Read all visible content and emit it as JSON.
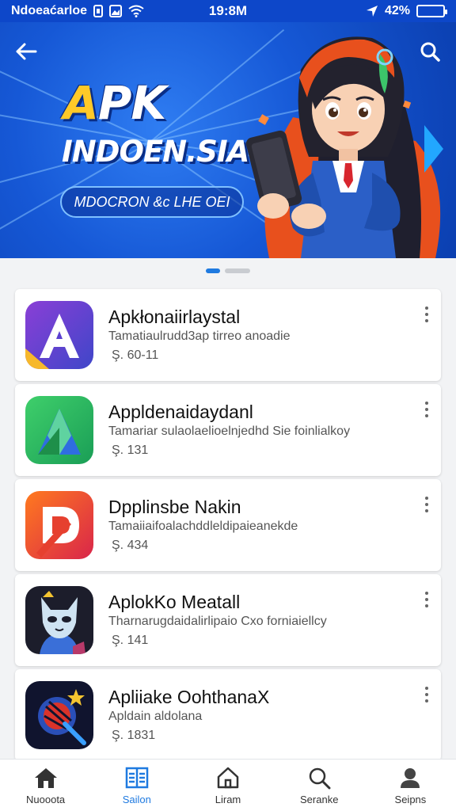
{
  "status_bar": {
    "carrier": "Ndoeaćarloe",
    "time": "19:8M",
    "battery_percent": "42%",
    "battery_level": 0.9
  },
  "hero": {
    "title": "APK",
    "subtitle": "INDOEN.SIA",
    "pill_text": "MDOCRON &c LHE OEI",
    "back_icon": "arrow-left-icon",
    "search_icon": "search-icon",
    "slide_count": 2,
    "active_slide": 1
  },
  "apps": [
    {
      "name": "Apkłonaiirlaystal",
      "desc": "Tamatiaulrudd3ap tirreo anoadie",
      "size": "Ş. 60-11",
      "icon": "letter-a-purple-icon"
    },
    {
      "name": "Appldenaidaydanl",
      "desc": "Tamariar sulaolaelioelnjedhd Sie foinlialkoy",
      "size": "Ş. 131",
      "icon": "letter-a-green-icon"
    },
    {
      "name": "Dpplinsbe Nakin",
      "desc": "Tamaiiaifoalachddleldipaieanekde",
      "size": "Ş. 434",
      "icon": "letter-d-orange-icon"
    },
    {
      "name": "AplokKo Meatall",
      "desc": "Tharnarugdaidalirlipaio Cxo forniaiellcy",
      "size": "Ş. 141",
      "icon": "cat-mask-icon"
    },
    {
      "name": "Apliiake OohthanaX",
      "desc": "Apldain aldolana",
      "size": "Ş. 1831",
      "icon": "ball-star-icon"
    }
  ],
  "bottom_nav": [
    {
      "label": "Nuooota",
      "icon": "home-icon",
      "active": false
    },
    {
      "label": "Sailon",
      "icon": "book-icon",
      "active": true
    },
    {
      "label": "Liram",
      "icon": "house-outline-icon",
      "active": false
    },
    {
      "label": "Seranke",
      "icon": "search-icon",
      "active": false
    },
    {
      "label": "Seipns",
      "icon": "person-icon",
      "active": false
    }
  ],
  "colors": {
    "status_bar": "#0d47c9",
    "accent": "#1f7ae0",
    "hero_title_accent": "#ffc928"
  }
}
